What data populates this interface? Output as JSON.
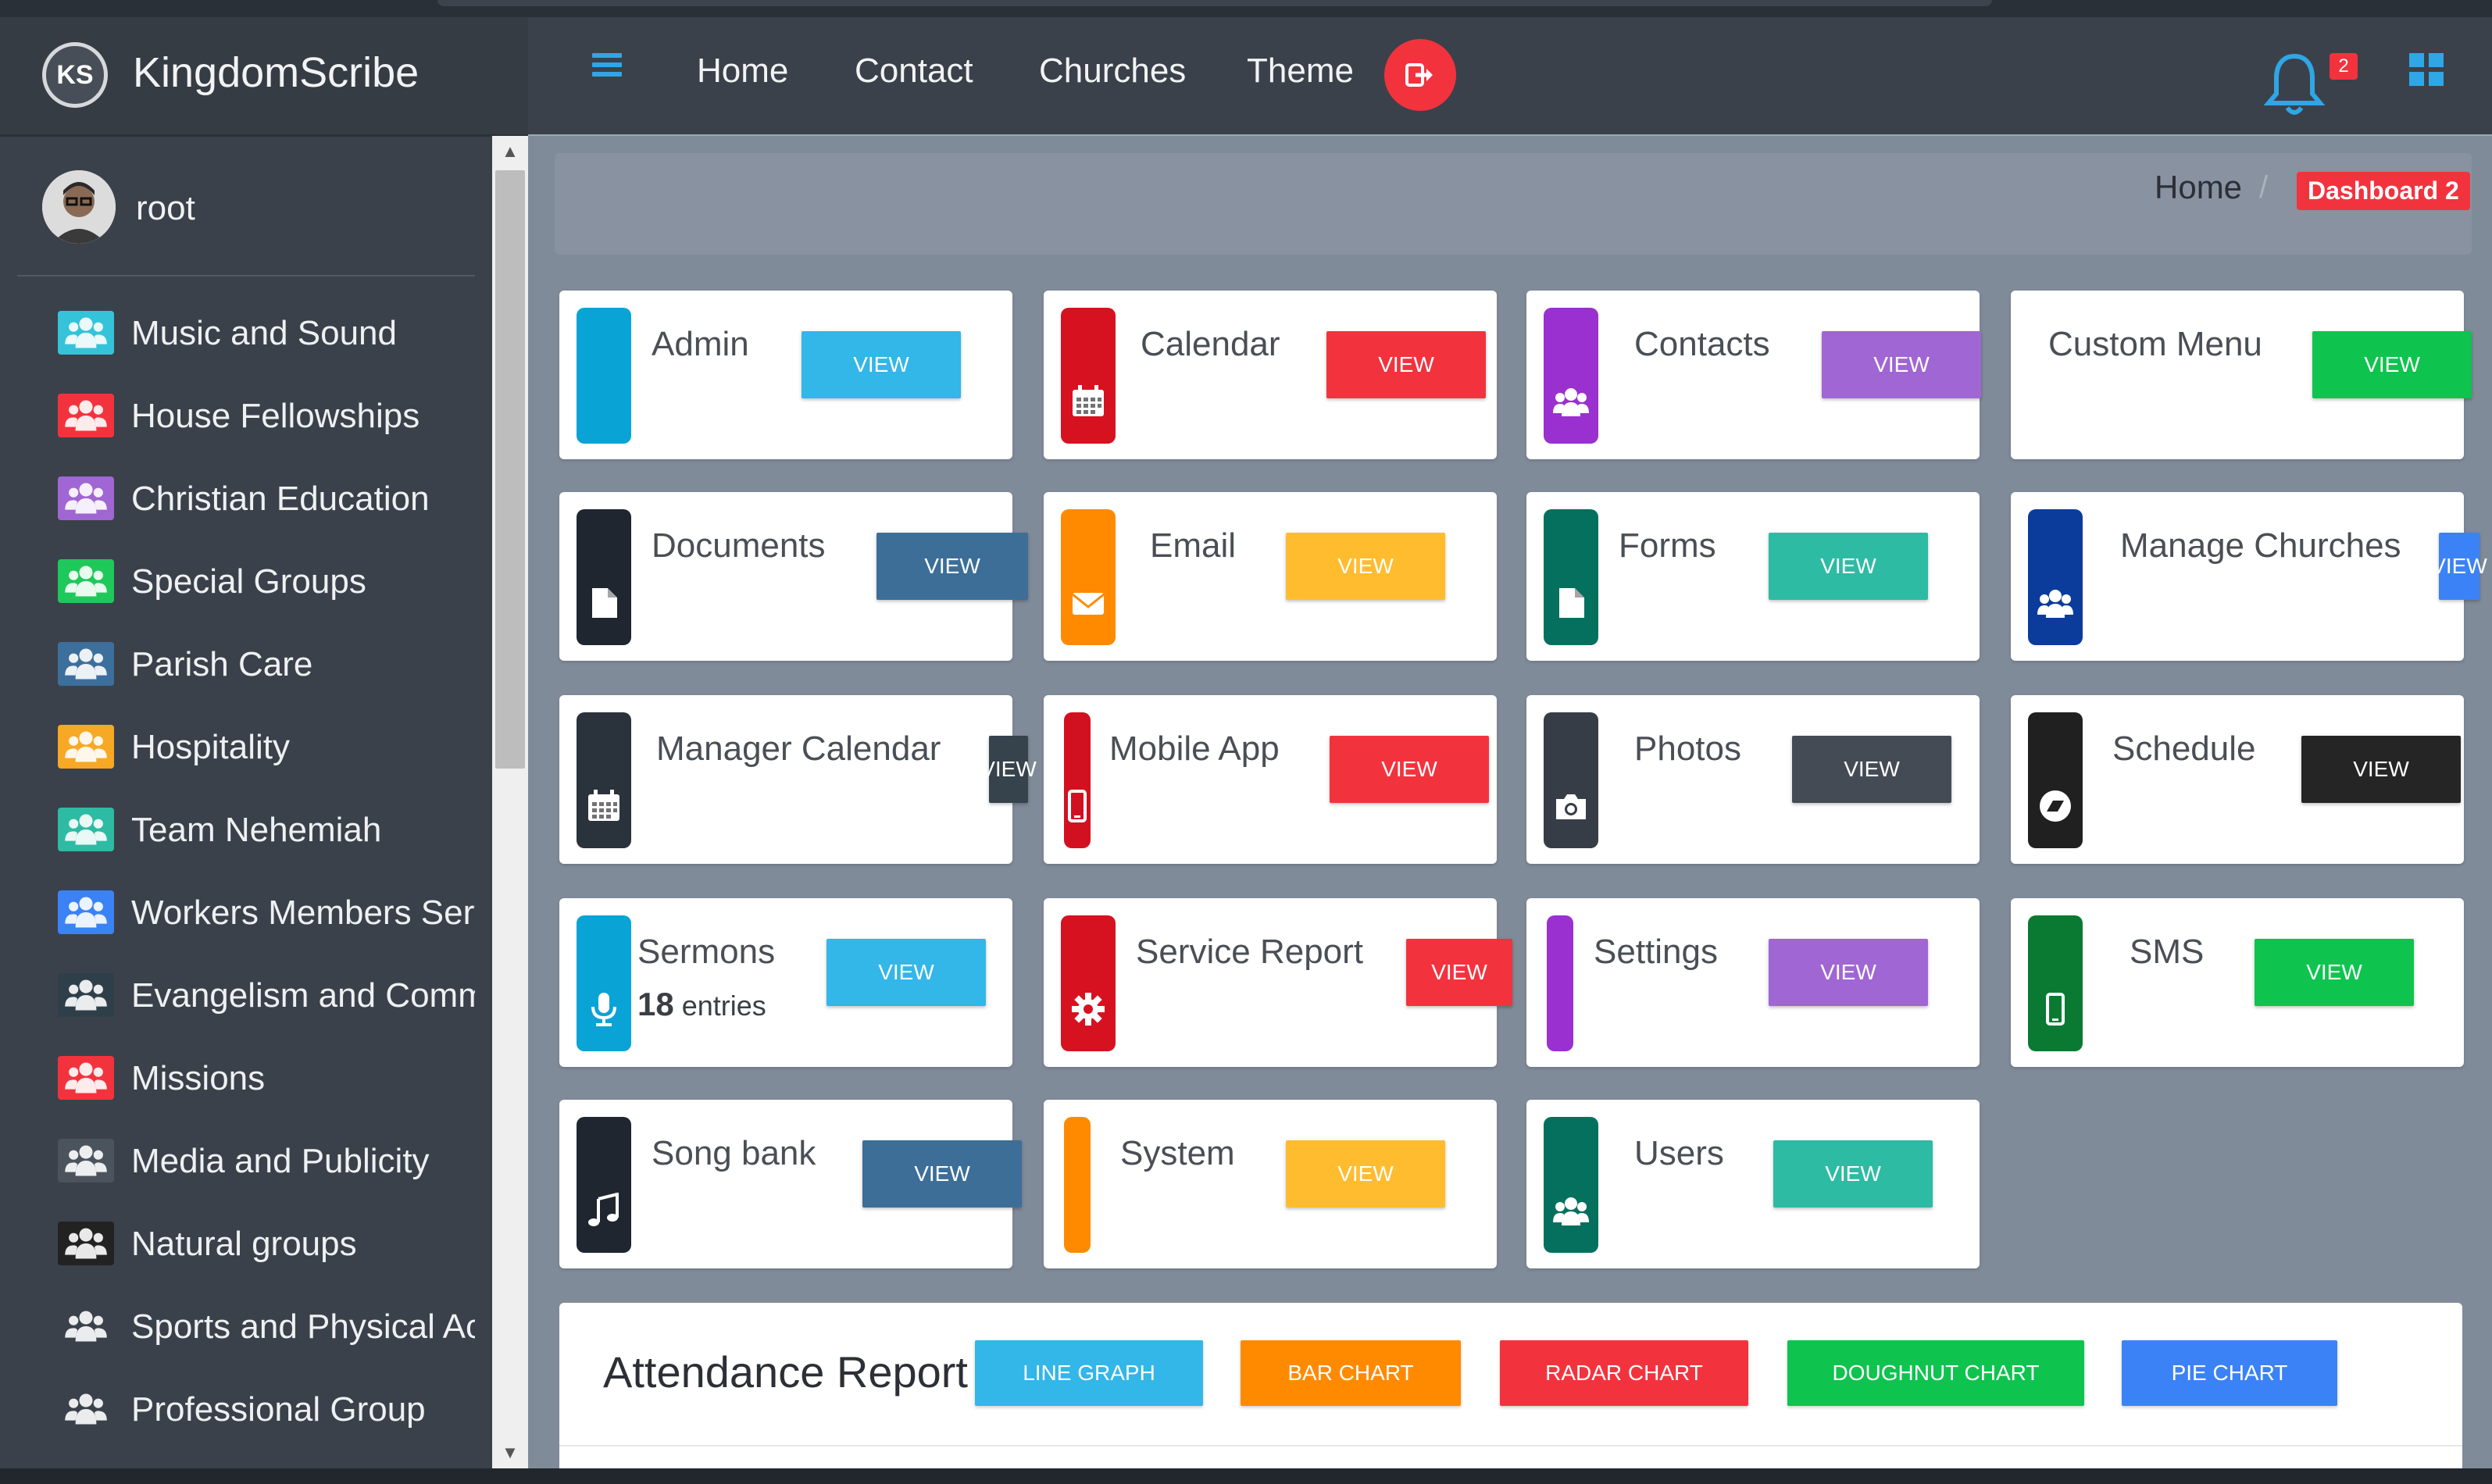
{
  "app": {
    "logo_text": "KS",
    "name": "KingdomScribe"
  },
  "user": {
    "name": "root"
  },
  "sidebar": {
    "items": [
      {
        "label": "Music and Sound",
        "color": "#34c3d8"
      },
      {
        "label": "House Fellowships",
        "color": "#f2333e"
      },
      {
        "label": "Christian Education",
        "color": "#a066d3"
      },
      {
        "label": "Special Groups",
        "color": "#1fc85a"
      },
      {
        "label": "Parish Care",
        "color": "#3d6f9c"
      },
      {
        "label": "Hospitality",
        "color": "#f7a824"
      },
      {
        "label": "Team Nehemiah",
        "color": "#2dbba3"
      },
      {
        "label": "Workers Members Serv",
        "color": "#3b82f6"
      },
      {
        "label": "Evangelism and Comm",
        "color": "#2f3f4a"
      },
      {
        "label": "Missions",
        "color": "#f2333e"
      },
      {
        "label": "Media and Publicity",
        "color": "#4b535d"
      },
      {
        "label": "Natural groups",
        "color": "#222222"
      },
      {
        "label": "Sports and Physical Act",
        "color": "#3b414a"
      },
      {
        "label": "Professional Group",
        "color": "#3b414a"
      }
    ]
  },
  "nav": {
    "links": [
      "Home",
      "Contact",
      "Churches",
      "Theme"
    ],
    "notification_count": "2"
  },
  "breadcrumb": {
    "home": "Home",
    "separator": "/",
    "active": "Dashboard 2"
  },
  "modules": [
    {
      "title": "Admin",
      "button": "VIEW",
      "ribbon": "#0aa3d6",
      "btn_color": "#33b6e8",
      "icon": "none"
    },
    {
      "title": "Calendar",
      "button": "VIEW",
      "ribbon": "#d61221",
      "btn_color": "#f2333e",
      "icon": "calendar-icon"
    },
    {
      "title": "Contacts",
      "button": "VIEW",
      "ribbon": "#9a30cf",
      "btn_color": "#a066d3",
      "icon": "users-icon"
    },
    {
      "title": "Custom Menu",
      "button": "VIEW",
      "ribbon": "none",
      "btn_color": "#0ec44e",
      "icon": "none"
    },
    {
      "title": "Documents",
      "button": "VIEW",
      "ribbon": "#1f2630",
      "btn_color": "#3c6e98",
      "icon": "document-icon"
    },
    {
      "title": "Email",
      "button": "VIEW",
      "ribbon": "#ff8a00",
      "btn_color": "#ffbc2f",
      "icon": "envelope-icon"
    },
    {
      "title": "Forms",
      "button": "VIEW",
      "ribbon": "#06705e",
      "btn_color": "#2dbba3",
      "icon": "form-icon"
    },
    {
      "title": "Manage Churches",
      "button": "VIEW",
      "ribbon": "#0b3c9c",
      "btn_color": "#3b82f6",
      "icon": "users-icon"
    },
    {
      "title": "Manager Calendar",
      "button": "VIEW",
      "ribbon": "#2a323b",
      "btn_color": "#36424c",
      "icon": "calendar-icon"
    },
    {
      "title": "Mobile App",
      "button": "VIEW",
      "ribbon": "#d21120",
      "btn_color": "#f2333e",
      "icon": "mobile-icon"
    },
    {
      "title": "Photos",
      "button": "VIEW",
      "ribbon": "#373d46",
      "btn_color": "#454b55",
      "icon": "camera-icon"
    },
    {
      "title": "Schedule",
      "button": "VIEW",
      "ribbon": "#202020",
      "btn_color": "#252525",
      "icon": "compass-icon"
    },
    {
      "title": "Sermons",
      "subtitle_count": "18",
      "subtitle_text": "entries",
      "button": "VIEW",
      "ribbon": "#0aa3d6",
      "btn_color": "#33b6e8",
      "icon": "microphone-icon"
    },
    {
      "title": "Service Report",
      "button": "VIEW",
      "ribbon": "#d61221",
      "btn_color": "#f2333e",
      "icon": "gear-icon"
    },
    {
      "title": "Settings",
      "button": "VIEW",
      "ribbon": "#9a30cf",
      "btn_color": "#a066d3",
      "icon": "none"
    },
    {
      "title": "SMS",
      "button": "VIEW",
      "ribbon": "#0a7a32",
      "btn_color": "#0ec44e",
      "icon": "mobile-icon"
    },
    {
      "title": "Song bank",
      "button": "VIEW",
      "ribbon": "#1f2630",
      "btn_color": "#3c6e98",
      "icon": "music-icon"
    },
    {
      "title": "System",
      "button": "VIEW",
      "ribbon": "#ff8a00",
      "btn_color": "#ffbc2f",
      "icon": "none"
    },
    {
      "title": "Users",
      "button": "VIEW",
      "ribbon": "#06705e",
      "btn_color": "#2dbba3",
      "icon": "users-icon"
    }
  ],
  "attendance": {
    "title": "Attendance Report",
    "buttons": [
      {
        "label": "LINE GRAPH",
        "color": "#33b6e8"
      },
      {
        "label": "BAR CHART",
        "color": "#ff8a00"
      },
      {
        "label": "RADAR CHART",
        "color": "#f2333e"
      },
      {
        "label": "DOUGHNUT CHART",
        "color": "#0ec44e"
      },
      {
        "label": "PIE CHART",
        "color": "#3b82f6"
      }
    ]
  }
}
